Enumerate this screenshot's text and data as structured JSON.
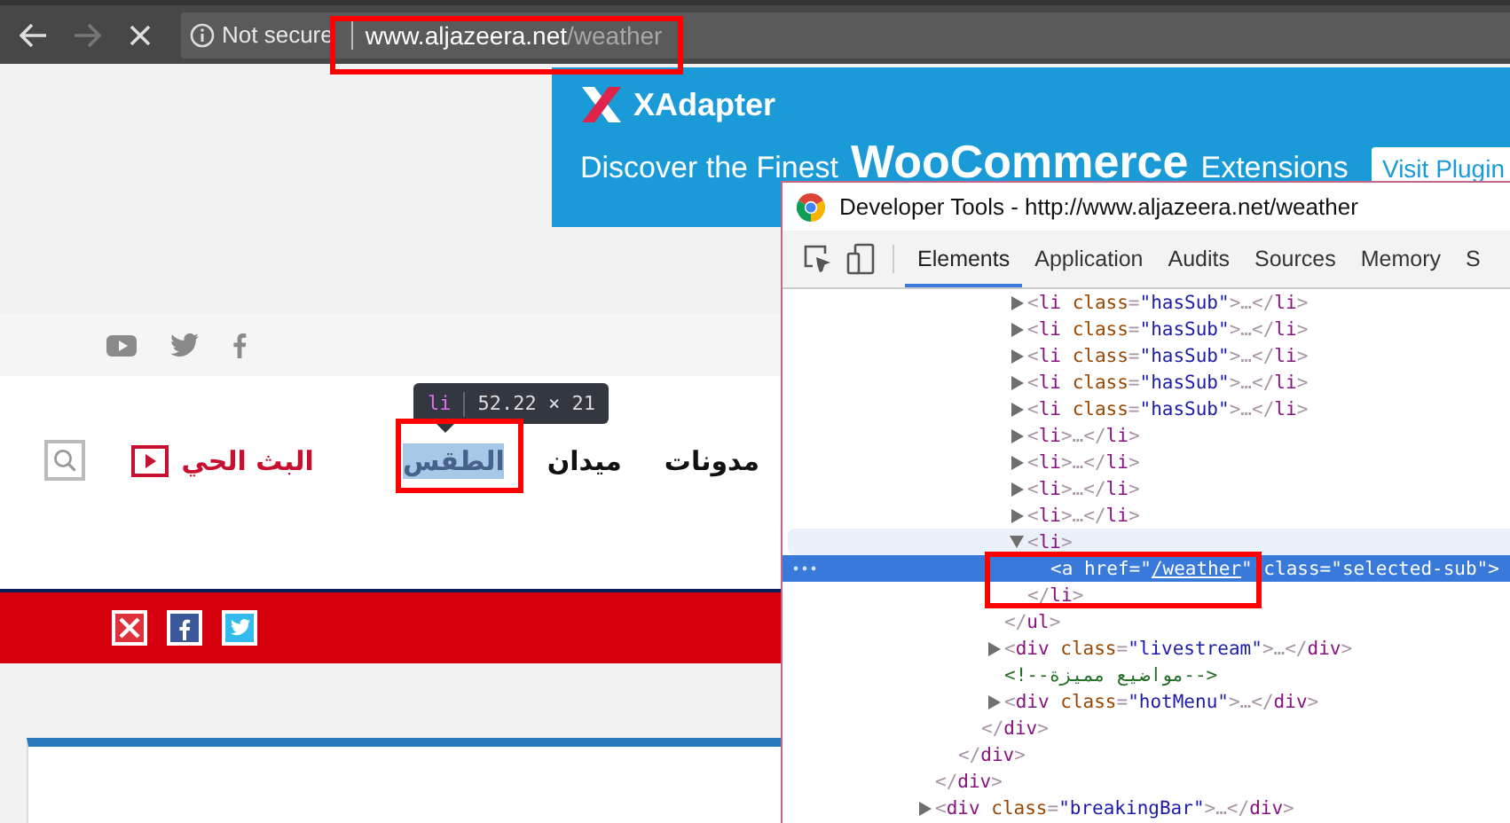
{
  "browser": {
    "security_label": "Not secure",
    "url_host": "www.aljazeera.net",
    "url_path": "/weather"
  },
  "ad": {
    "brand": "XAdapter",
    "line_start": "Discover the Finest",
    "line_product": "WooCommerce",
    "line_end": "Extensions",
    "button": "Visit Plugin"
  },
  "nav": {
    "items": [
      {
        "label": "مدونات",
        "selected": false
      },
      {
        "label": "ميدان",
        "selected": false
      },
      {
        "label": "الطقس",
        "selected": true
      }
    ],
    "live": "البث الحي"
  },
  "inspect_tooltip": {
    "tag": "li",
    "size": "52.22 × 21"
  },
  "devtools": {
    "title": "Developer Tools - http://www.aljazeera.net/weather",
    "tabs": [
      {
        "label": "Elements",
        "selected": true
      },
      {
        "label": "Application",
        "selected": false
      },
      {
        "label": "Audits",
        "selected": false
      },
      {
        "label": "Sources",
        "selected": false
      },
      {
        "label": "Memory",
        "selected": false
      },
      {
        "label": "S",
        "selected": false
      }
    ],
    "tree": [
      {
        "kind": "partial",
        "close": "</div>",
        "children": [
          {
            "kind": "partial",
            "close": "</div>",
            "children": [
              {
                "kind": "partial",
                "close": "</div>",
                "children": [
                  {
                    "kind": "partial",
                    "close": "</ul>",
                    "children": [
                      {
                        "kind": "collapsed",
                        "text": "<li class=\"hasSub\">…</li>"
                      },
                      {
                        "kind": "collapsed",
                        "text": "<li class=\"hasSub\">…</li>"
                      },
                      {
                        "kind": "collapsed",
                        "text": "<li class=\"hasSub\">…</li>"
                      },
                      {
                        "kind": "collapsed",
                        "text": "<li class=\"hasSub\">…</li>"
                      },
                      {
                        "kind": "collapsed",
                        "text": "<li class=\"hasSub\">…</li>"
                      },
                      {
                        "kind": "collapsed",
                        "text": "<li>…</li>"
                      },
                      {
                        "kind": "collapsed",
                        "text": "<li>…</li>"
                      },
                      {
                        "kind": "collapsed",
                        "text": "<li>…</li>"
                      },
                      {
                        "kind": "collapsed",
                        "text": "<li>…</li>"
                      },
                      {
                        "kind": "expanded",
                        "open": "<li>",
                        "hovered": true,
                        "close": "</li>",
                        "children": [
                          {
                            "kind": "element",
                            "text": "<a href=\"/weather\" class=\"selected-sub\">",
                            "selected": true,
                            "link": true
                          }
                        ]
                      }
                    ]
                  },
                  {
                    "kind": "collapsed",
                    "text": "<div class=\"livestream\">…</div>"
                  },
                  {
                    "kind": "comment",
                    "text": "<!--مواضيع مميزة-->"
                  },
                  {
                    "kind": "collapsed",
                    "text": "<div class=\"hotMenu\">…</div>"
                  }
                ]
              }
            ]
          }
        ]
      },
      {
        "kind": "collapsed",
        "text": "<div class=\"breakingBar\">…</div>"
      }
    ]
  }
}
